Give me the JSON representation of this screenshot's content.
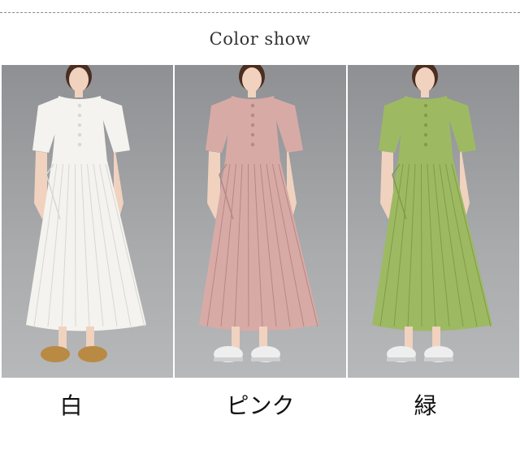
{
  "header": {
    "title": "Color show"
  },
  "variants": [
    {
      "label": "白",
      "dress_color": "#f4f3ef",
      "dress_shade": "#d9d7d1",
      "shoe_color": "#b98a43",
      "shoe_style": "sandal"
    },
    {
      "label": "ピンク",
      "dress_color": "#d8aaa6",
      "dress_shade": "#b78783",
      "shoe_color": "#eeeeee",
      "shoe_style": "sneaker"
    },
    {
      "label": "緑",
      "dress_color": "#9dba63",
      "dress_shade": "#7f9c47",
      "shoe_color": "#eeeeee",
      "shoe_style": "sneaker"
    }
  ],
  "colors": {
    "background": "#ffffff",
    "panel_backdrop": "#a9abad",
    "skin": "#f0d2bf",
    "hair": "#4a2e21"
  }
}
